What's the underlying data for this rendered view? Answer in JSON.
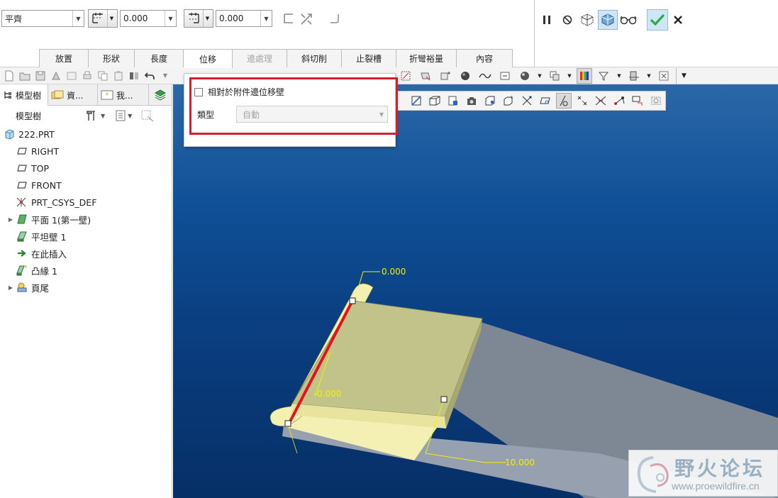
{
  "dashboard": {
    "type_combo": "平齊",
    "offset_value_1": "0.000",
    "offset_value_2": "0.000",
    "tabs": [
      {
        "label": "放置",
        "state": "normal"
      },
      {
        "label": "形狀",
        "state": "normal"
      },
      {
        "label": "長度",
        "state": "normal"
      },
      {
        "label": "位移",
        "state": "active"
      },
      {
        "label": "邊處理",
        "state": "disabled"
      },
      {
        "label": "斜切削",
        "state": "normal"
      },
      {
        "label": "止裂槽",
        "state": "normal"
      },
      {
        "label": "折彎裕量",
        "state": "normal"
      },
      {
        "label": "內容",
        "state": "normal"
      }
    ]
  },
  "popup": {
    "checkbox_label": "相對於附件邊位移壁",
    "checkbox_checked": false,
    "type_label": "類型",
    "type_value": "自動"
  },
  "navigator": {
    "tabs": [
      "模型樹",
      "資...",
      "我..."
    ],
    "header_label": "模型樹",
    "tree": [
      {
        "label": "222.PRT",
        "icon": "part-icon",
        "indent": 0,
        "expandable": false
      },
      {
        "label": "RIGHT",
        "icon": "datum-plane-icon",
        "indent": 1,
        "expandable": false
      },
      {
        "label": "TOP",
        "icon": "datum-plane-icon",
        "indent": 1,
        "expandable": false
      },
      {
        "label": "FRONT",
        "icon": "datum-plane-icon",
        "indent": 1,
        "expandable": false
      },
      {
        "label": "PRT_CSYS_DEF",
        "icon": "csys-icon",
        "indent": 1,
        "expandable": false
      },
      {
        "label": "平面 1(第一壁)",
        "icon": "first-wall-icon",
        "indent": 1,
        "expandable": true
      },
      {
        "label": "平坦壁 1",
        "icon": "flat-wall-icon",
        "indent": 1,
        "expandable": false
      },
      {
        "label": "在此插入",
        "icon": "insert-here-icon",
        "indent": 1,
        "expandable": false
      },
      {
        "label": "凸緣 1",
        "icon": "flange-icon",
        "indent": 1,
        "expandable": false
      },
      {
        "label": "頁尾",
        "icon": "footer-icon",
        "indent": 1,
        "expandable": true
      }
    ]
  },
  "viewport": {
    "dim_top": "0.000",
    "dim_middle": "0.000",
    "dim_length": "10.000"
  },
  "colors": {
    "viewport_top": "#2a68a8",
    "viewport_bottom": "#062f66",
    "highlight_red": "#d4202a",
    "flange_yellow": "#f3f0b0",
    "flat_wall_gray": "#7e8794",
    "dim_yellow": "#f4f000",
    "confirm_green": "#2aa84a"
  },
  "watermark": {
    "cn": "野火论坛",
    "en": "www.proewildfire.cn"
  }
}
